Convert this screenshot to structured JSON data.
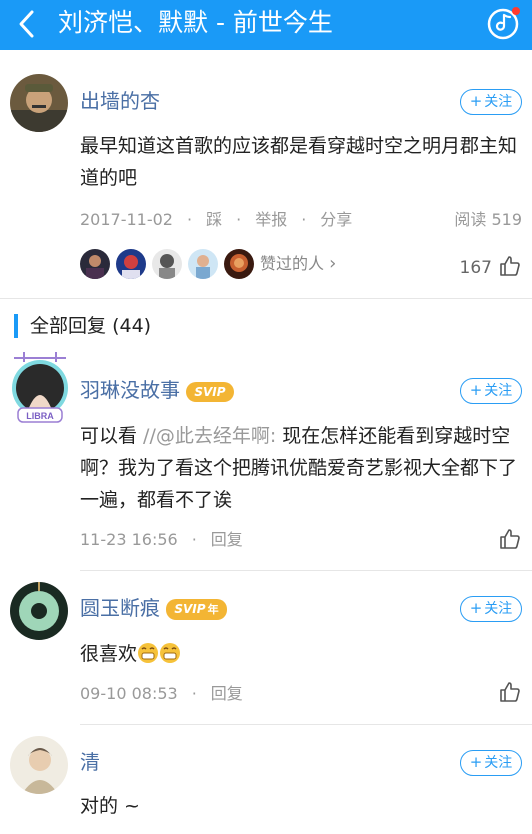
{
  "header": {
    "title": "刘济恺、默默 - 前世今生",
    "bg_color": "#1a9af7"
  },
  "main_comment": {
    "username": "出墙的杏",
    "follow_label": "关注",
    "content": "最早知道这首歌的应该都是看穿越时空之明月郡主知道的吧",
    "date": "2017-11-02",
    "actions": [
      "踩",
      "举报",
      "分享"
    ],
    "read_label": "阅读",
    "read_count": "519",
    "likers_label": "赞过的人",
    "like_count": "167"
  },
  "section": {
    "title": "全部回复",
    "count": "(44)"
  },
  "replies": [
    {
      "username": "羽琳没故事",
      "badge": "SVIP",
      "follow_label": "关注",
      "content_prefix": "可以看 ",
      "quote": "//@此去经年啊:",
      "content_rest": " 现在怎样还能看到穿越时空啊？我为了看这个把腾讯优酷爱奇艺影视大全都下了一遍，都看不了诶",
      "time": "11-23 16:56",
      "reply_label": "回复"
    },
    {
      "username": "圆玉断痕",
      "badge": "SVIP",
      "badge_suffix": "年",
      "follow_label": "关注",
      "content": "很喜欢",
      "time": "09-10 08:53",
      "reply_label": "回复"
    },
    {
      "username": "清",
      "follow_label": "关注",
      "content": "对的 ~"
    }
  ],
  "icons": {
    "back": "chevron-left-icon",
    "music": "music-note-icon",
    "like": "thumbs-up-icon",
    "emoji": "grin-emoji-icon"
  }
}
